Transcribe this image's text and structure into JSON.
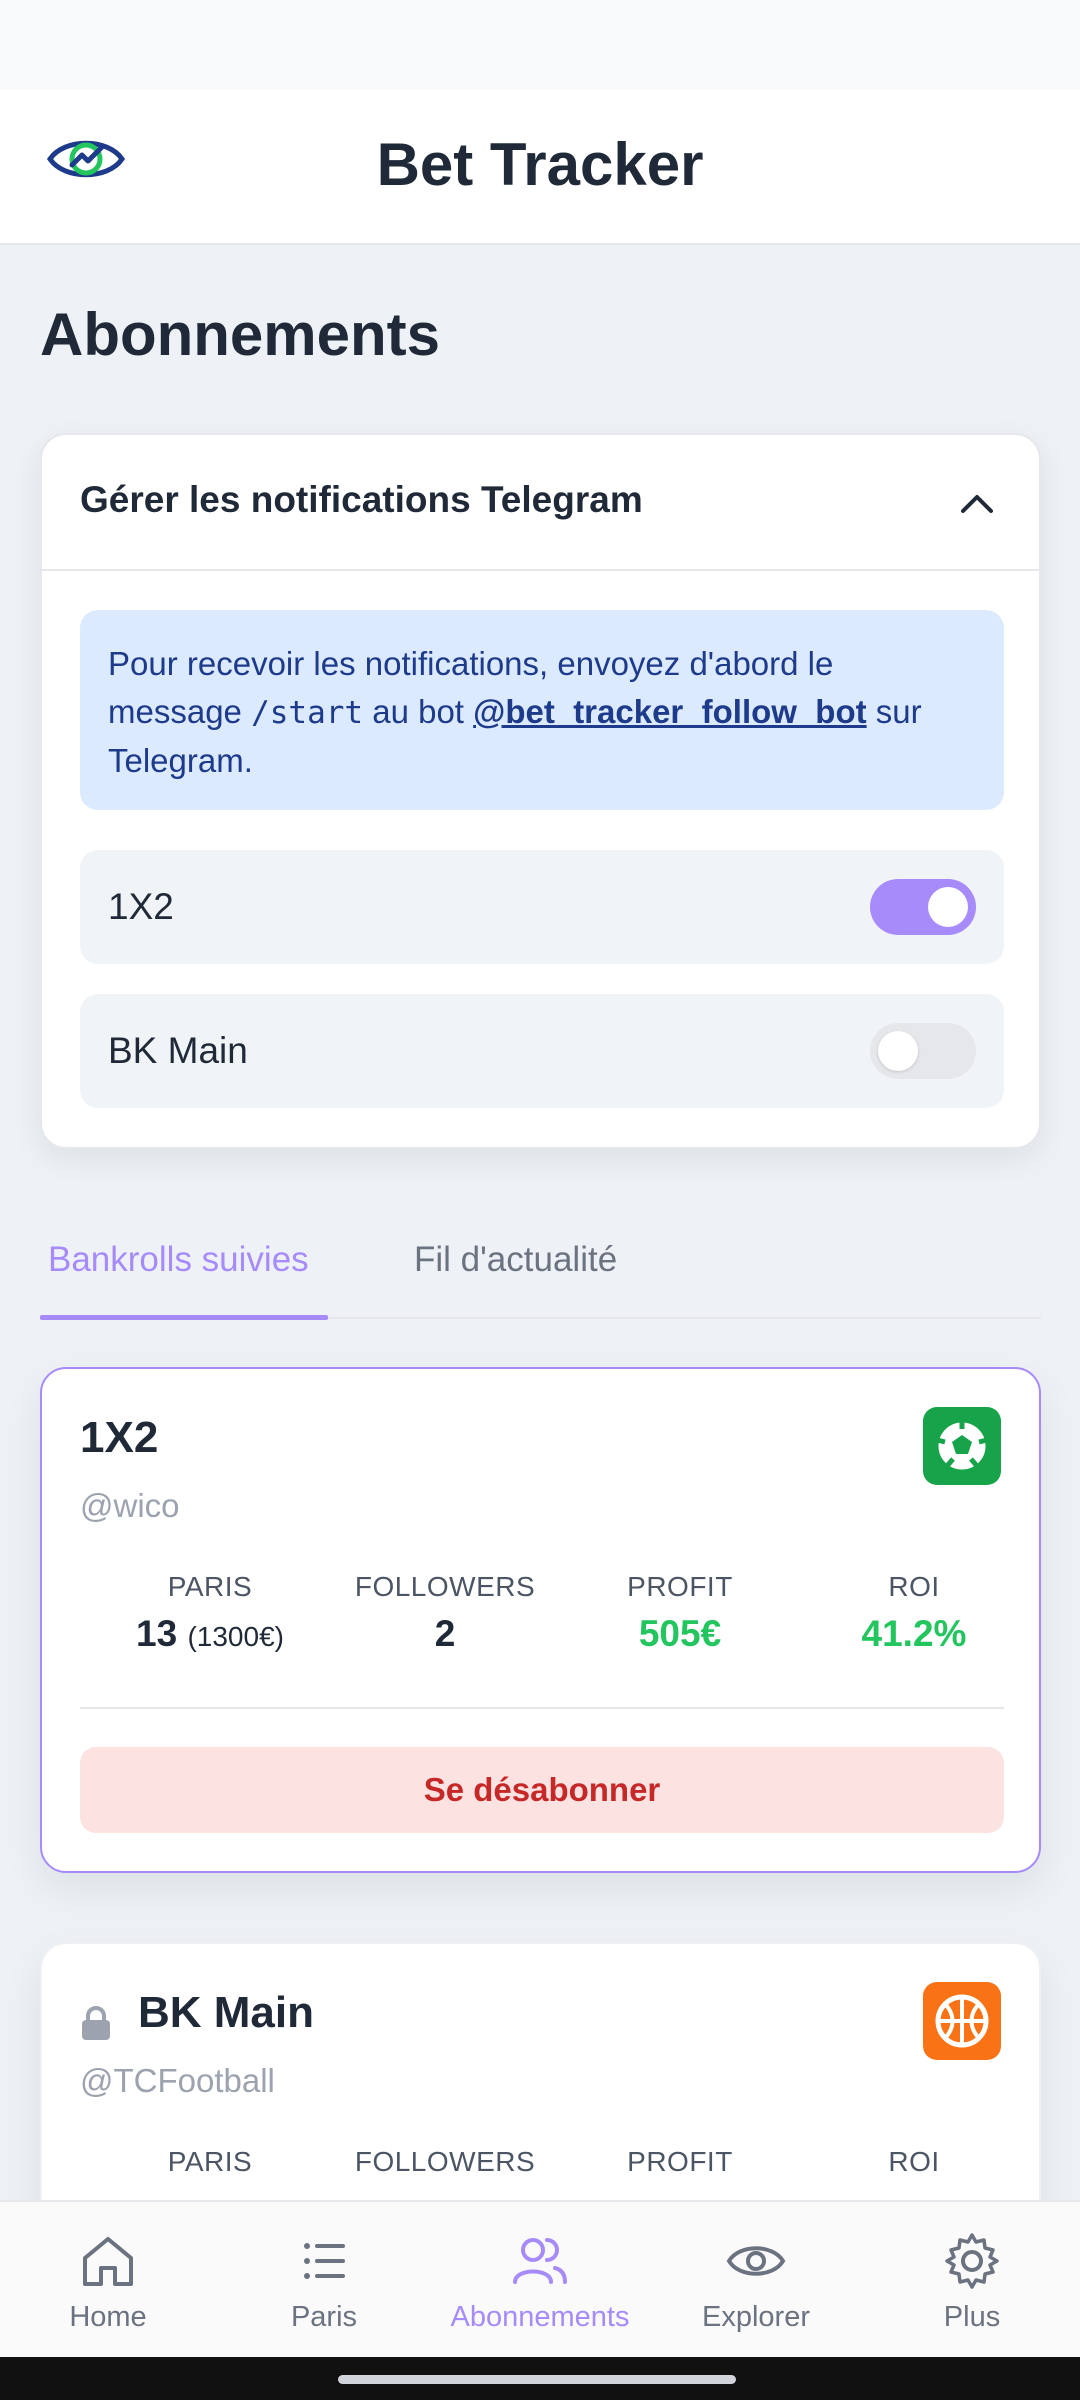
{
  "app": {
    "title": "Bet Tracker"
  },
  "page": {
    "title": "Abonnements"
  },
  "notifications": {
    "title": "Gérer les notifications Telegram",
    "info_prefix": "Pour recevoir les notifications, envoyez d'abord le message ",
    "info_command": "/start",
    "info_middle": " au bot ",
    "info_bot": "@bet_tracker_follow_bot",
    "info_suffix": " sur Telegram.",
    "toggles": [
      {
        "label": "1X2",
        "enabled": true
      },
      {
        "label": "BK Main",
        "enabled": false
      }
    ]
  },
  "tabs": [
    {
      "label": "Bankrolls suivies",
      "active": true
    },
    {
      "label": "Fil d'actualité",
      "active": false
    }
  ],
  "bankrolls": [
    {
      "name": "1X2",
      "handle": "@wico",
      "sport_icon": "soccer-ball-icon",
      "sport_color": "#16a34a",
      "stats": {
        "paris_label": "PARIS",
        "paris_value": "13",
        "paris_amount": "(1300€)",
        "followers_label": "FOLLOWERS",
        "followers_value": "2",
        "profit_label": "PROFIT",
        "profit_value": "505€",
        "roi_label": "ROI",
        "roi_value": "41.2%"
      },
      "action_label": "Se désabonner"
    },
    {
      "name": "BK Main",
      "handle": "@TCFootball",
      "locked": true,
      "sport_icon": "basketball-icon",
      "sport_color": "#f97316",
      "stats": {
        "paris_label": "PARIS",
        "followers_label": "FOLLOWERS",
        "profit_label": "PROFIT",
        "roi_label": "ROI"
      }
    }
  ],
  "nav": [
    {
      "label": "Home",
      "icon": "home-icon"
    },
    {
      "label": "Paris",
      "icon": "list-icon"
    },
    {
      "label": "Abonnements",
      "icon": "users-icon",
      "active": true
    },
    {
      "label": "Explorer",
      "icon": "eye-icon"
    },
    {
      "label": "Plus",
      "icon": "gear-icon"
    }
  ],
  "colors": {
    "accent": "#a78bfa",
    "profit": "#22c55e",
    "danger": "#c62828"
  }
}
